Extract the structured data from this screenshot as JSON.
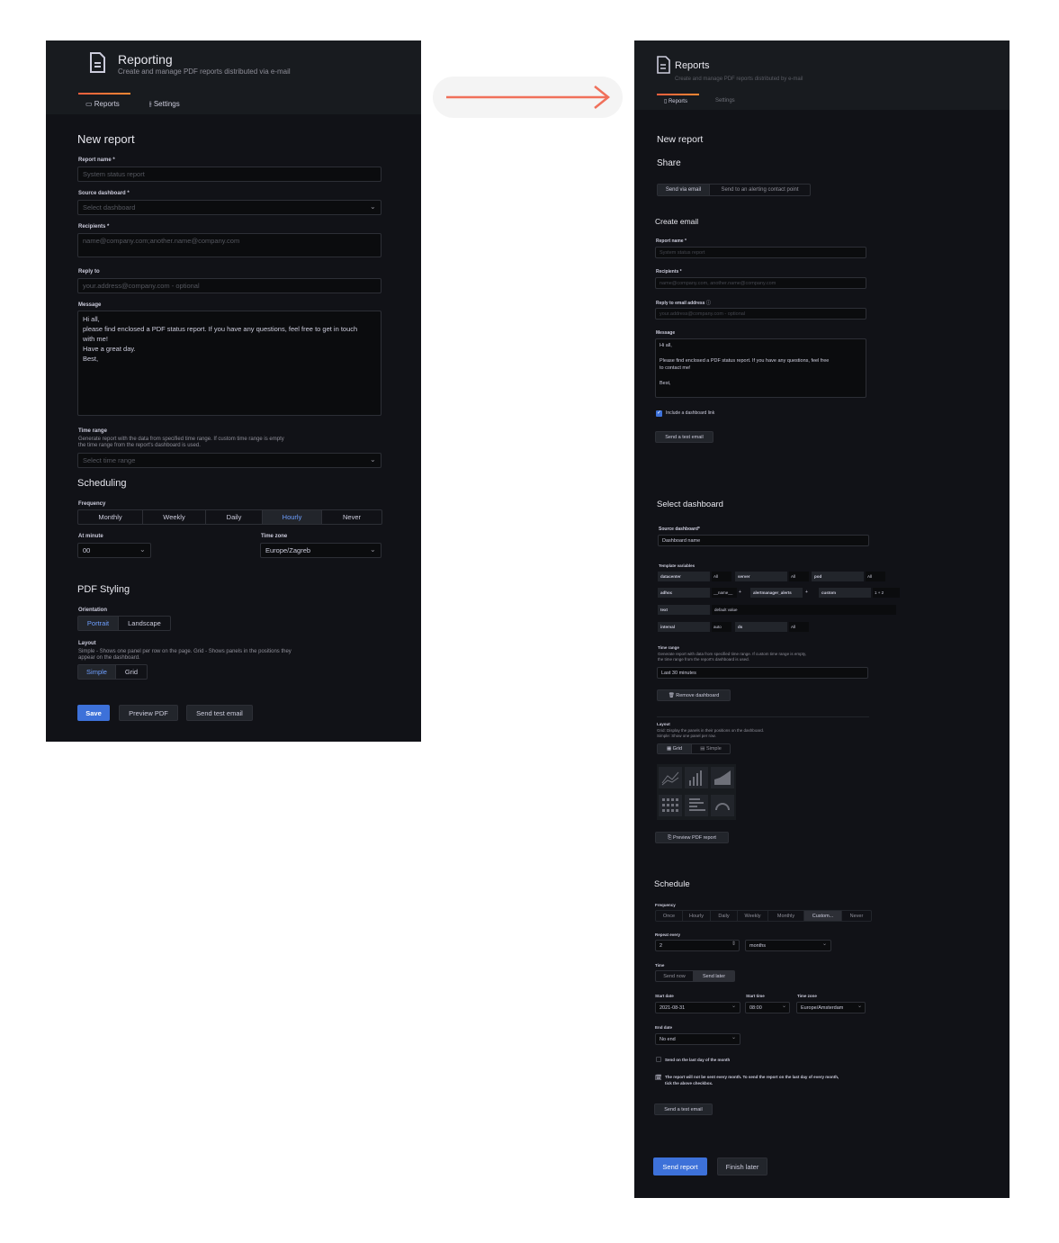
{
  "left": {
    "header": {
      "title": "Reporting",
      "subtitle": "Create and manage PDF reports distributed via e-mail"
    },
    "tabs": [
      {
        "label": "Reports",
        "active": true
      },
      {
        "label": "Settings",
        "active": false
      }
    ],
    "page_title": "New report",
    "report_name": {
      "label": "Report name *",
      "placeholder": "System status report"
    },
    "source_dashboard": {
      "label": "Source dashboard *",
      "placeholder": "Select dashboard"
    },
    "recipients": {
      "label": "Recipients *",
      "placeholder": "name@company.com;another.name@company.com"
    },
    "reply_to": {
      "label": "Reply to",
      "placeholder": "your.address@company.com - optional"
    },
    "message": {
      "label": "Message",
      "lines": [
        "Hi all,",
        "please find enclosed a PDF status report. If you have any questions, feel free to get in touch",
        "with me!",
        "Have a great day.",
        "Best,"
      ]
    },
    "time_range": {
      "label": "Time range",
      "desc1": "Generate report with the data from specified time range. If custom time range is empty",
      "desc2": "the time range from the report's dashboard is used.",
      "placeholder": "Select time range"
    },
    "scheduling": {
      "title": "Scheduling",
      "frequency_label": "Frequency",
      "frequency": [
        "Monthly",
        "Weekly",
        "Daily",
        "Hourly",
        "Never"
      ],
      "selected": "Hourly",
      "at_minute_label": "At minute",
      "at_minute": "00",
      "timezone_label": "Time zone",
      "timezone": "Europe/Zagreb"
    },
    "pdf_styling": {
      "title": "PDF Styling",
      "orientation_label": "Orientation",
      "orientation": [
        "Portrait",
        "Landscape"
      ],
      "layout_label": "Layout",
      "layout_desc1": "Simple - Shows one panel per row on the page. Grid - Shows panels in the positions they",
      "layout_desc2": "appear on the dashboard.",
      "layout": [
        "Simple",
        "Grid"
      ]
    },
    "actions": {
      "save": "Save",
      "preview": "Preview PDF",
      "test": "Send test email"
    }
  },
  "right": {
    "header": {
      "title": "Reports",
      "subtitle": "Create and manage PDF reports distributed by e-mail"
    },
    "tabs": [
      {
        "label": "Reports",
        "active": true
      },
      {
        "label": "Settings",
        "active": false
      }
    ],
    "page_title": "New report",
    "share": {
      "title": "Share",
      "options": [
        "Send via email",
        "Send to an alerting contact point"
      ]
    },
    "create_email": {
      "title": "Create email",
      "report_name_label": "Report name *",
      "report_name_ph": "System status report",
      "recipients_label": "Recipients *",
      "recipients_ph": "name@company.com, another.name@company.com",
      "reply_label": "Reply to email address",
      "reply_ph": "your.address@company.com - optional",
      "message_label": "Message",
      "message_lines": [
        "Hi all,",
        "Please find enclosed a PDF status report. If you have any questions, feel free",
        "to contact me!",
        "Best,"
      ],
      "include_link": "Include a dashboard link",
      "test_btn": "Send a test email"
    },
    "select_dashboard": {
      "title": "Select dashboard",
      "source_label": "Source dashboard*",
      "source_value": "Dashboard name",
      "vars_label": "Template variables",
      "vars": [
        {
          "k1": "datacenter",
          "v1": "All",
          "k2": "server",
          "v2": "All",
          "k3": "pod",
          "v3": "All"
        },
        {
          "k1": "adhoc",
          "v1": "__name__",
          "k2": "alertmanager_alerts",
          "k3": "custom",
          "v3": "1 + 2"
        },
        {
          "k1": "text",
          "v1": "default value"
        },
        {
          "k1": "interval",
          "v1": "auto",
          "k2": "ds",
          "v2": "All"
        }
      ],
      "time_label": "Time range",
      "time_desc1": "Generate report with data from specified time range. If custom time range is empty,",
      "time_desc2": "the time range from the report's dashboard is used.",
      "time_value": "Last 30 minutes",
      "remove_btn": "Remove dashboard",
      "layout_label": "Layout",
      "layout_desc1": "Grid: Display the panels in their positions on the dashboard.",
      "layout_desc2": "Simple: Show one panel per row.",
      "layout": [
        "Grid",
        "Simple"
      ],
      "preview_btn": "Preview PDF report"
    },
    "schedule": {
      "title": "Schedule",
      "frequency_label": "Frequency",
      "frequency": [
        "Once",
        "Hourly",
        "Daily",
        "Weekly",
        "Monthly",
        "Custom...",
        "Never"
      ],
      "selected": "Custom...",
      "repeat_label": "Repeat every",
      "repeat_value": "2",
      "repeat_unit": "months",
      "time_label": "Time",
      "time_options": [
        "Send now",
        "Send later"
      ],
      "start_date_label": "Start date",
      "start_date": "2021-08-31",
      "start_time_label": "Start time",
      "start_time": "08:00",
      "tz_label": "Time zone",
      "tz": "Europe/Amsterdam",
      "end_label": "End date",
      "end_value": "No end",
      "last_day": "Send on the last day of the month",
      "note1": "The report will not be sent every month. To send the report on the last day of every month,",
      "note2": "tick the above checkbox.",
      "test_btn": "Send a test email"
    },
    "actions": {
      "send": "Send report",
      "later": "Finish later"
    }
  },
  "colors": {
    "accent": "#3d71d9",
    "arrow": "#f0705a",
    "tab_underline": "#ff8833"
  }
}
